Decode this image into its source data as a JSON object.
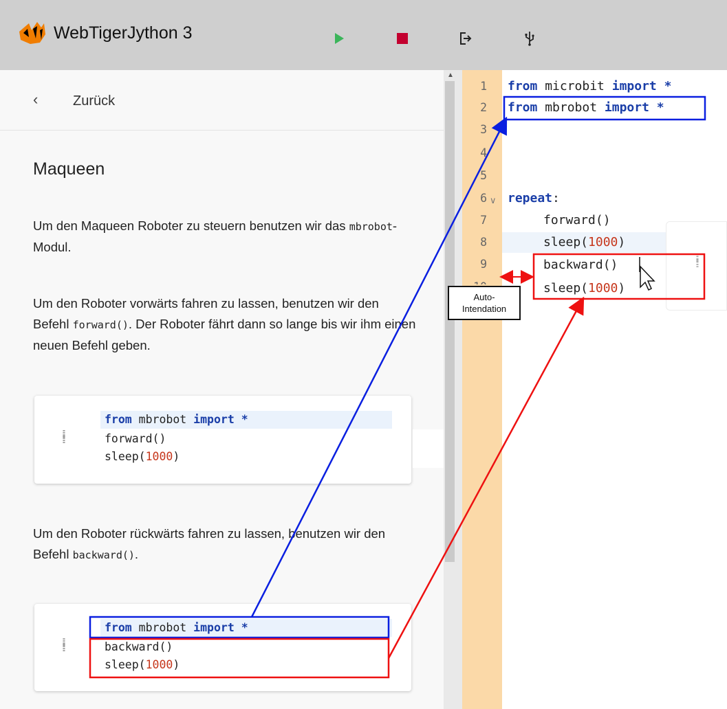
{
  "app": {
    "title": "WebTigerJython 3",
    "toolbar": {
      "run_icon": "play-icon",
      "stop_icon": "stop-icon",
      "export_icon": "export-icon",
      "usb_icon": "usb-icon"
    },
    "colors": {
      "header_bg": "#cfcfcf",
      "run": "#3bb55a",
      "stop": "#c3002f",
      "gutter": "#fbd9a8",
      "keyword": "#1a3ea8",
      "number": "#c6361b",
      "annotation_blue": "#0a1fe0",
      "annotation_red": "#ee1111"
    }
  },
  "left_panel": {
    "back_label": "Zurück",
    "title": "Maqueen",
    "para1": {
      "text_a": "Um den Maqueen Roboter zu steuern benutzen wir das ",
      "code": "mbrobot",
      "text_b": "-Modul."
    },
    "para2": {
      "text_a": "Um den Roboter vorwärts fahren zu lassen, benutzen wir den Befehl ",
      "code": "forward()",
      "text_b": ". Der Roboter fährt dann so lange bis wir ihm einen neuen Befehl geben."
    },
    "para3": {
      "text_a": "Um den Roboter rückwärts fahren zu lassen, benutzen wir den Befehl ",
      "code": "backward()",
      "text_b": "."
    },
    "snippet1": [
      {
        "kw1": "from",
        "mid": " mbrobot ",
        "kw2": "import",
        "rest": " *"
      },
      {
        "text": "forward()"
      },
      {
        "pre": "sleep(",
        "num": "1000",
        "post": ")"
      }
    ],
    "snippet2": [
      {
        "kw1": "from",
        "mid": " mbrobot ",
        "kw2": "import",
        "rest": " *"
      },
      {
        "text": "backward()"
      },
      {
        "pre": "sleep(",
        "num": "1000",
        "post": ")"
      }
    ]
  },
  "editor": {
    "line_numbers": [
      "1",
      "2",
      "3",
      "4",
      "5",
      "6",
      "7",
      "8",
      "9",
      "10"
    ],
    "lines": {
      "l1": {
        "kw1": "from",
        "mid": " microbit ",
        "kw2": "import",
        "rest": " *"
      },
      "l2": {
        "kw1": "from",
        "mid": " mbrobot ",
        "kw2": "import",
        "rest": " *"
      },
      "l6": {
        "kw": "repeat",
        "rest": ":"
      },
      "l7": "forward()",
      "l8": {
        "pre": "sleep(",
        "num": "1000",
        "post": ")"
      },
      "l9": "backward()",
      "l10": {
        "pre": "sleep(",
        "num": "1000",
        "post": ")"
      }
    }
  },
  "annotation": {
    "line1": "Auto-",
    "line2": "Intendation"
  }
}
